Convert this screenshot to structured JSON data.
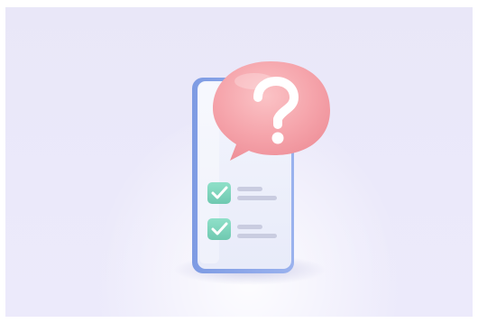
{
  "illustration": {
    "subject": "smartphone-with-checklist-and-question-bubble",
    "icons": [
      "smartphone-icon",
      "question-bubble-icon",
      "checkbox-checked-icon",
      "checkbox-checked-icon"
    ],
    "colors": {
      "background": "#ebe9fa",
      "phone_frame": "#8aa6e8",
      "phone_screen": "#eef1fc",
      "bubble": "#f4a1a8",
      "bubble_highlight": "#fbc6c9",
      "question_mark": "#ffffff",
      "checkbox": "#7dd6bf",
      "check_mark": "#ffffff",
      "text_lines": "#c9cce0"
    },
    "checklist": {
      "items": [
        {
          "checked": true,
          "lines": 2
        },
        {
          "checked": true,
          "lines": 2
        }
      ]
    }
  }
}
